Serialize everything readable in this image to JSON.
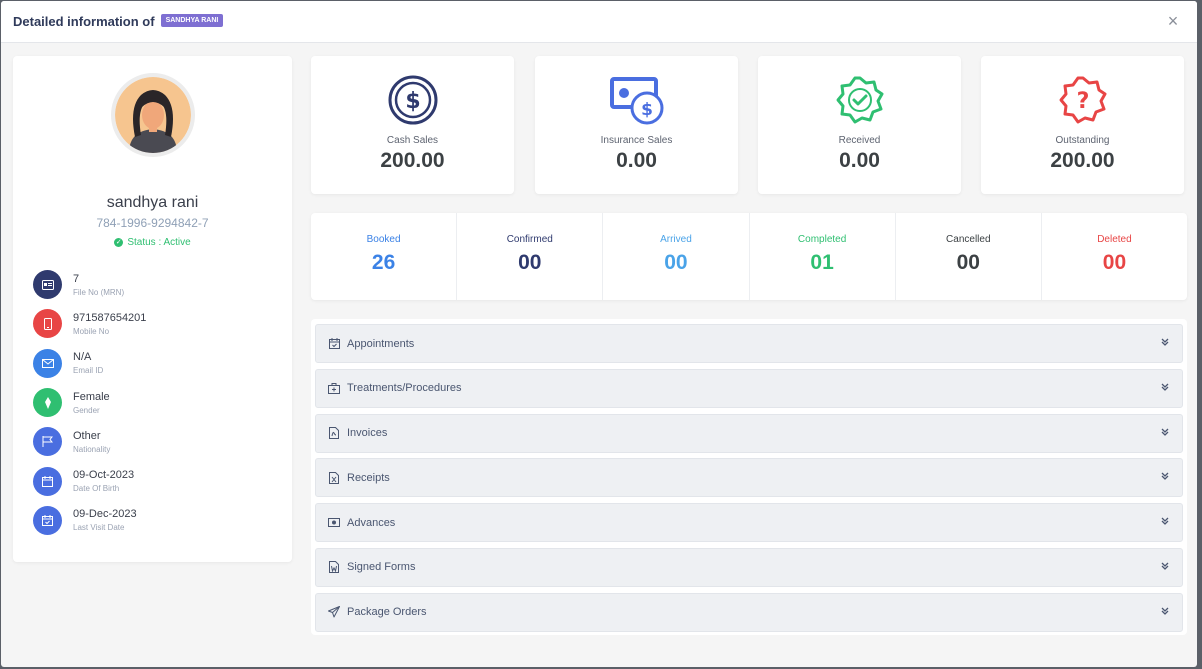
{
  "header": {
    "title": "Detailed information of",
    "badge": "SANDHYA RANI",
    "close_symbol": "×"
  },
  "profile": {
    "name": "sandhya rani",
    "id": "784-1996-9294842-7",
    "status": "Status : Active",
    "items": [
      {
        "value": "7",
        "label": "File No (MRN)",
        "icon": "id-card-icon",
        "color": "#2f3a6e"
      },
      {
        "value": "971587654201",
        "label": "Mobile No",
        "icon": "mobile-icon",
        "color": "#e84545"
      },
      {
        "value": "N/A",
        "label": "Email ID",
        "icon": "envelope-icon",
        "color": "#3b82e6"
      },
      {
        "value": "Female",
        "label": "Gender",
        "icon": "gender-icon",
        "color": "#2fbf71"
      },
      {
        "value": "Other",
        "label": "Nationality",
        "icon": "flag-icon",
        "color": "#4a6ee0"
      },
      {
        "value": "09-Oct-2023",
        "label": "Date Of Birth",
        "icon": "calendar-icon",
        "color": "#4a6ee0"
      },
      {
        "value": "09-Dec-2023",
        "label": "Last Visit Date",
        "icon": "calendar-check-icon",
        "color": "#4a6ee0"
      }
    ]
  },
  "stats": [
    {
      "label": "Cash Sales",
      "value": "200.00",
      "icon": "dollar-circle-icon",
      "color": "#2f3a6e"
    },
    {
      "label": "Insurance Sales",
      "value": "0.00",
      "icon": "money-bill-icon",
      "color": "#4a6ee0"
    },
    {
      "label": "Received",
      "value": "0.00",
      "icon": "check-badge-icon",
      "color": "#2fbf71"
    },
    {
      "label": "Outstanding",
      "value": "200.00",
      "icon": "question-badge-icon",
      "color": "#e84545"
    }
  ],
  "appointments": [
    {
      "label": "Booked",
      "value": "26",
      "color": "#3b82e6"
    },
    {
      "label": "Confirmed",
      "value": "00",
      "color": "#2f3a6e"
    },
    {
      "label": "Arrived",
      "value": "00",
      "color": "#4aa3e8"
    },
    {
      "label": "Completed",
      "value": "01",
      "color": "#2fbf71"
    },
    {
      "label": "Cancelled",
      "value": "00",
      "color": "#3c4144"
    },
    {
      "label": "Deleted",
      "value": "00",
      "color": "#e84545"
    }
  ],
  "sections": [
    {
      "label": "Appointments",
      "icon": "calendar-check-icon"
    },
    {
      "label": "Treatments/Procedures",
      "icon": "medkit-icon"
    },
    {
      "label": "Invoices",
      "icon": "file-pdf-icon"
    },
    {
      "label": "Receipts",
      "icon": "file-excel-icon"
    },
    {
      "label": "Advances",
      "icon": "money-icon"
    },
    {
      "label": "Signed Forms",
      "icon": "file-word-icon"
    },
    {
      "label": "Package Orders",
      "icon": "paper-plane-icon"
    }
  ],
  "chevron_symbol": "»"
}
